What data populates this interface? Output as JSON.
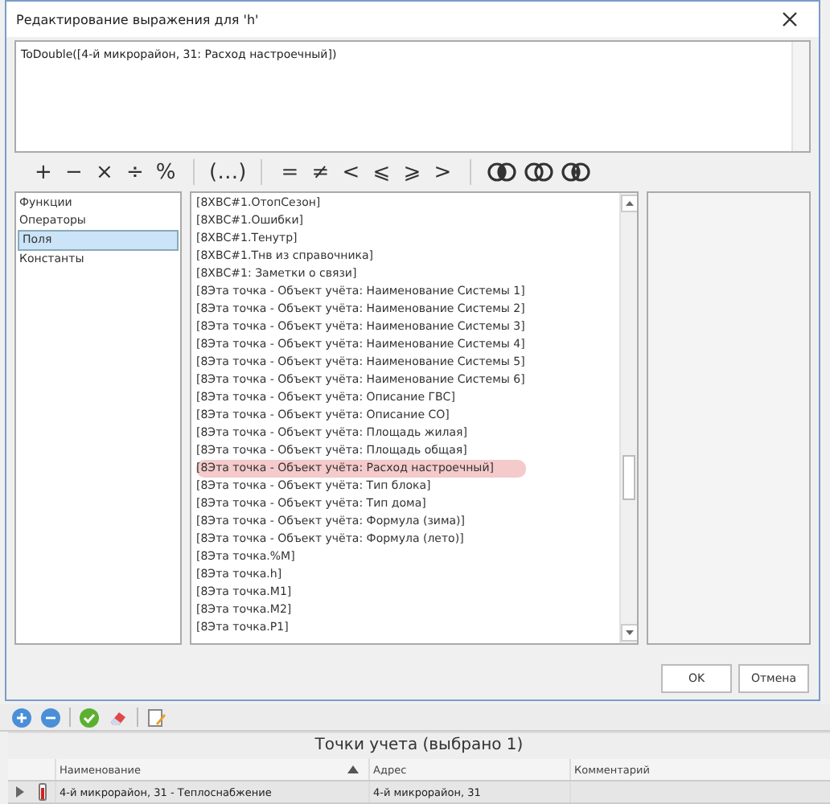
{
  "dialog": {
    "title": "Редактирование выражения для 'h'",
    "expression": "ToDouble([4-й микрорайон, 31: Расход настроечный])"
  },
  "operators": [
    {
      "kind": "char",
      "symbol": "+"
    },
    {
      "kind": "char",
      "symbol": "−"
    },
    {
      "kind": "char",
      "symbol": "×"
    },
    {
      "kind": "char",
      "symbol": "÷"
    },
    {
      "kind": "char",
      "symbol": "%"
    },
    {
      "kind": "sep"
    },
    {
      "kind": "char",
      "symbol": "(…)"
    },
    {
      "kind": "sep"
    },
    {
      "kind": "char",
      "symbol": "="
    },
    {
      "kind": "char",
      "symbol": "≠"
    },
    {
      "kind": "char",
      "symbol": "<"
    },
    {
      "kind": "char",
      "symbol": "⩽"
    },
    {
      "kind": "char",
      "symbol": "⩾"
    },
    {
      "kind": "char",
      "symbol": ">"
    },
    {
      "kind": "sep"
    },
    {
      "kind": "and"
    },
    {
      "kind": "or"
    },
    {
      "kind": "xor"
    }
  ],
  "categories": [
    {
      "label": "Функции",
      "selected": false
    },
    {
      "label": "Операторы",
      "selected": false
    },
    {
      "label": "Поля",
      "selected": true
    },
    {
      "label": "Константы",
      "selected": false
    }
  ],
  "fields": [
    {
      "label": "[8ХВС#1.ОтопСезон]",
      "selected": false
    },
    {
      "label": "[8ХВС#1.Ошибки]",
      "selected": false
    },
    {
      "label": "[8ХВС#1.Тенутр]",
      "selected": false
    },
    {
      "label": "[8ХВС#1.Тнв из справочника]",
      "selected": false
    },
    {
      "label": "[8ХВС#1: Заметки о связи]",
      "selected": false
    },
    {
      "label": "[8Эта точка - Объект учёта: Наименование Системы 1]",
      "selected": false
    },
    {
      "label": "[8Эта точка - Объект учёта: Наименование Системы 2]",
      "selected": false
    },
    {
      "label": "[8Эта точка - Объект учёта: Наименование Системы 3]",
      "selected": false
    },
    {
      "label": "[8Эта точка - Объект учёта: Наименование Системы 4]",
      "selected": false
    },
    {
      "label": "[8Эта точка - Объект учёта: Наименование Системы 5]",
      "selected": false
    },
    {
      "label": "[8Эта точка - Объект учёта: Наименование Системы 6]",
      "selected": false
    },
    {
      "label": "[8Эта точка - Объект учёта: Описание ГВС]",
      "selected": false
    },
    {
      "label": "[8Эта точка - Объект учёта: Описание СО]",
      "selected": false
    },
    {
      "label": "[8Эта точка - Объект учёта: Площадь жилая]",
      "selected": false
    },
    {
      "label": "[8Эта точка - Объект учёта: Площадь общая]",
      "selected": false
    },
    {
      "label": "[8Эта точка - Объект учёта: Расход настроечный]",
      "selected": true
    },
    {
      "label": "[8Эта точка - Объект учёта: Тип блока]",
      "selected": false
    },
    {
      "label": "[8Эта точка - Объект учёта: Тип дома]",
      "selected": false
    },
    {
      "label": "[8Эта точка - Объект учёта: Формула (зима)]",
      "selected": false
    },
    {
      "label": "[8Эта точка - Объект учёта: Формула (лето)]",
      "selected": false
    },
    {
      "label": "[8Эта точка.%M]",
      "selected": false
    },
    {
      "label": "[8Эта точка.h]",
      "selected": false
    },
    {
      "label": "[8Эта точка.M1]",
      "selected": false
    },
    {
      "label": "[8Эта точка.M2]",
      "selected": false
    },
    {
      "label": "[8Эта точка.P1]",
      "selected": false
    }
  ],
  "buttons": [
    "OK",
    "Отмена"
  ],
  "grid": {
    "title": "Точки учета (выбрано 1)",
    "columns": [
      "Наименование",
      "Адрес",
      "Комментарий"
    ],
    "rows": [
      {
        "name": "4-й микрорайон, 31 - Теплоснабжение",
        "address": "4-й микрорайон, 31"
      }
    ]
  }
}
